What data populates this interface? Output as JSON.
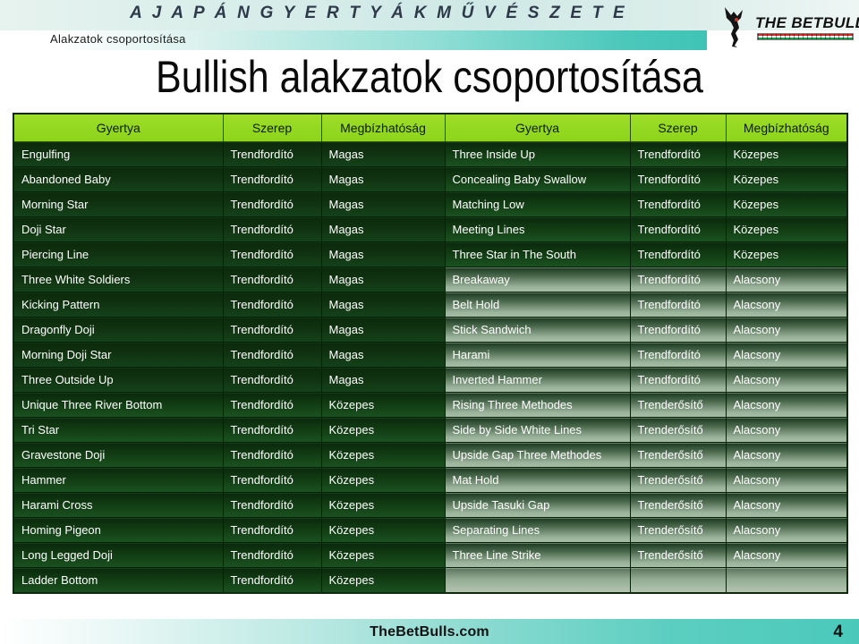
{
  "banner": {
    "title": "A  J A P Á N   G Y E R T Y Á K   M Ű V É S Z E T E",
    "subtitle": "Alakzatok  csoportosítása"
  },
  "logo": {
    "wordmark": "THE BETBULLS",
    "bull_icon": "bull-silhouette-icon",
    "flag_icon": "hungarian-flag-bar-icon"
  },
  "page_title": "Bullish alakzatok csoportosítása",
  "table": {
    "headers": [
      "Gyertya",
      "Szerep",
      "Megbízhatóság",
      "Gyertya",
      "Szerep",
      "Megbízhatóság"
    ],
    "rows": [
      {
        "left": [
          "Engulfing",
          "Trendfordító",
          "Magas"
        ],
        "right": [
          "Three Inside Up",
          "Trendfordító",
          "Közepes"
        ],
        "left_tone": "tone-dark",
        "right_tone": "tone-mid"
      },
      {
        "left": [
          "Abandoned Baby",
          "Trendfordító",
          "Magas"
        ],
        "right": [
          "Concealing Baby Swallow",
          "Trendfordító",
          "Közepes"
        ],
        "left_tone": "tone-dark",
        "right_tone": "tone-mid"
      },
      {
        "left": [
          "Morning Star",
          "Trendfordító",
          "Magas"
        ],
        "right": [
          "Matching Low",
          "Trendfordító",
          "Közepes"
        ],
        "left_tone": "tone-dark",
        "right_tone": "tone-mid"
      },
      {
        "left": [
          "Doji Star",
          "Trendfordító",
          "Magas"
        ],
        "right": [
          "Meeting Lines",
          "Trendfordító",
          "Közepes"
        ],
        "left_tone": "tone-dark",
        "right_tone": "tone-mid"
      },
      {
        "left": [
          "Piercing Line",
          "Trendfordító",
          "Magas"
        ],
        "right": [
          "Three Star in The South",
          "Trendfordító",
          "Közepes"
        ],
        "left_tone": "tone-dark",
        "right_tone": "tone-mid"
      },
      {
        "left": [
          "Three White Soldiers",
          "Trendfordító",
          "Magas"
        ],
        "right": [
          "Breakaway",
          "Trendfordító",
          "Alacsony"
        ],
        "left_tone": "tone-dark",
        "right_tone": "tone-light"
      },
      {
        "left": [
          "Kicking Pattern",
          "Trendfordító",
          "Magas"
        ],
        "right": [
          "Belt Hold",
          "Trendfordító",
          "Alacsony"
        ],
        "left_tone": "tone-dark",
        "right_tone": "tone-light"
      },
      {
        "left": [
          "Dragonfly Doji",
          "Trendfordító",
          "Magas"
        ],
        "right": [
          "Stick Sandwich",
          "Trendfordító",
          "Alacsony"
        ],
        "left_tone": "tone-dark",
        "right_tone": "tone-light"
      },
      {
        "left": [
          "Morning Doji Star",
          "Trendfordító",
          "Magas"
        ],
        "right": [
          "Harami",
          "Trendfordító",
          "Alacsony"
        ],
        "left_tone": "tone-dark",
        "right_tone": "tone-light"
      },
      {
        "left": [
          "Three Outside Up",
          "Trendfordító",
          "Magas"
        ],
        "right": [
          "Inverted Hammer",
          "Trendfordító",
          "Alacsony"
        ],
        "left_tone": "tone-dark",
        "right_tone": "tone-light"
      },
      {
        "left": [
          "Unique Three River Bottom",
          "Trendfordító",
          "Közepes"
        ],
        "right": [
          "Rising Three Methodes",
          "Trenderősítő",
          "Alacsony"
        ],
        "left_tone": "tone-mid",
        "right_tone": "tone-light"
      },
      {
        "left": [
          "Tri Star",
          "Trendfordító",
          "Közepes"
        ],
        "right": [
          "Side by Side White Lines",
          "Trenderősítő",
          "Alacsony"
        ],
        "left_tone": "tone-mid",
        "right_tone": "tone-light"
      },
      {
        "left": [
          "Gravestone Doji",
          "Trendfordító",
          "Közepes"
        ],
        "right": [
          "Upside Gap Three Methodes",
          "Trenderősítő",
          "Alacsony"
        ],
        "left_tone": "tone-mid",
        "right_tone": "tone-light"
      },
      {
        "left": [
          "Hammer",
          "Trendfordító",
          "Közepes"
        ],
        "right": [
          "Mat Hold",
          "Trenderősítő",
          "Alacsony"
        ],
        "left_tone": "tone-mid",
        "right_tone": "tone-light"
      },
      {
        "left": [
          "Harami Cross",
          "Trendfordító",
          "Közepes"
        ],
        "right": [
          "Upside Tasuki Gap",
          "Trenderősítő",
          "Alacsony"
        ],
        "left_tone": "tone-mid",
        "right_tone": "tone-light"
      },
      {
        "left": [
          "Homing Pigeon",
          "Trendfordító",
          "Közepes"
        ],
        "right": [
          "Separating Lines",
          "Trenderősítő",
          "Alacsony"
        ],
        "left_tone": "tone-mid",
        "right_tone": "tone-light"
      },
      {
        "left": [
          "Long Legged Doji",
          "Trendfordító",
          "Közepes"
        ],
        "right": [
          "Three Line Strike",
          "Trenderősítő",
          "Alacsony"
        ],
        "left_tone": "tone-mid",
        "right_tone": "tone-light"
      },
      {
        "left": [
          "Ladder Bottom",
          "Trendfordító",
          "Közepes"
        ],
        "right": [
          "",
          "",
          ""
        ],
        "left_tone": "tone-mid",
        "right_tone": "tone-empty"
      }
    ]
  },
  "footer": {
    "site": "TheBetBulls.com",
    "page_number": "4"
  },
  "colors": {
    "header_green": "#95d922",
    "row_dark_green": "#0b2a0b",
    "row_light_sage": "#a7bda6",
    "banner_teal": "#4ac9ba",
    "flag_red": "#cf2a23",
    "flag_green": "#169b4e"
  }
}
